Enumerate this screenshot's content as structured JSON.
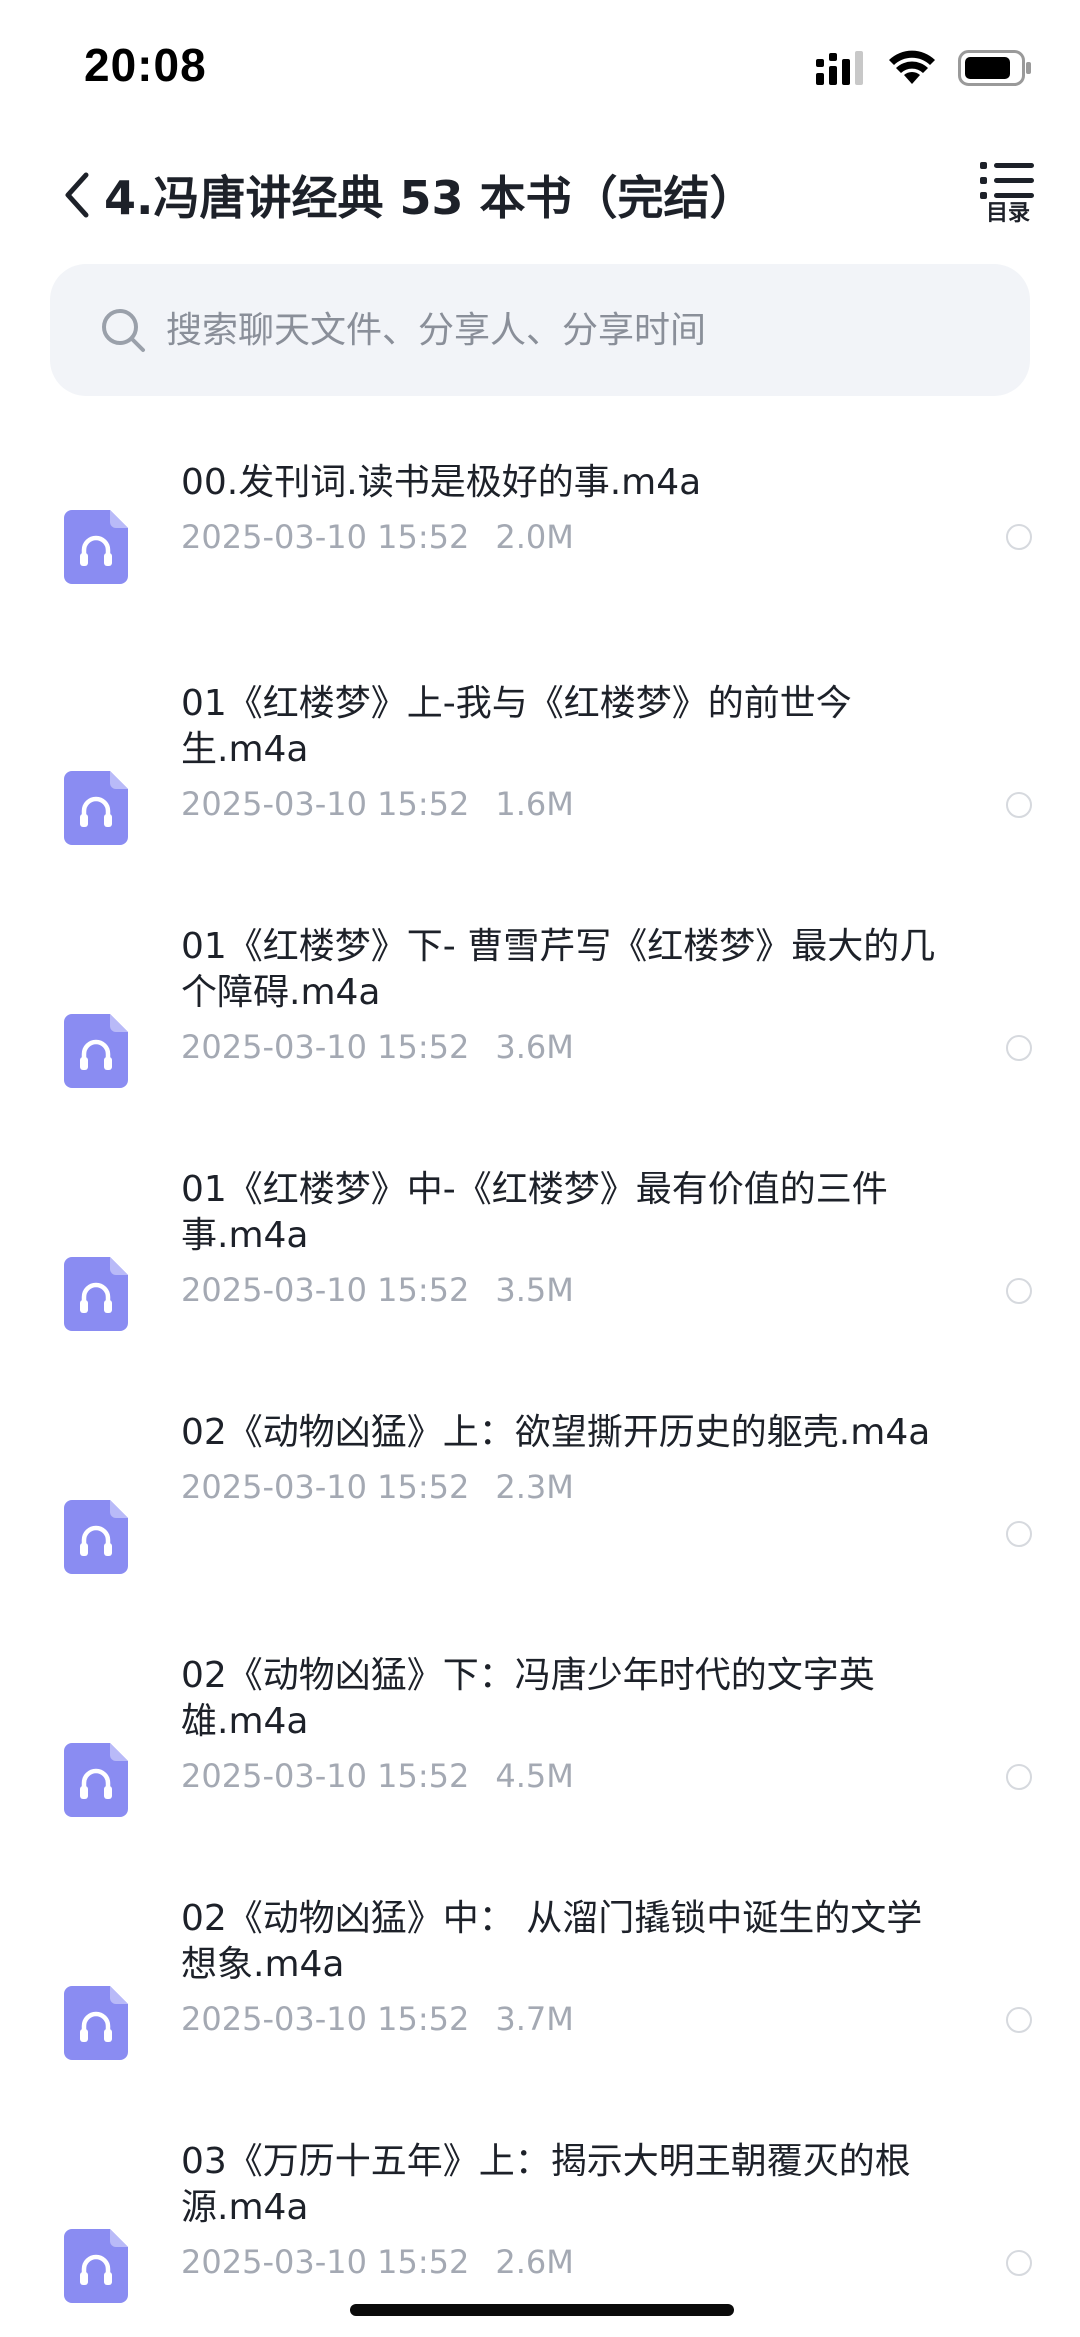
{
  "status_bar": {
    "time": "20:08"
  },
  "nav": {
    "title": "4.冯唐讲经典 53 本书（完结）",
    "toc_label": "目录"
  },
  "search": {
    "placeholder": "搜索聊天文件、分享人、分享时间"
  },
  "files": [
    {
      "name": "00.发刊词.读书是极好的事.m4a",
      "date": "2025-03-10 15:52",
      "size": "2.0M"
    },
    {
      "name": "01《红楼梦》上-我与《红楼梦》的前世今生.m4a",
      "date": "2025-03-10 15:52",
      "size": "1.6M"
    },
    {
      "name": "01《红楼梦》下- 曹雪芹写《红楼梦》最大的几个障碍.m4a",
      "date": "2025-03-10 15:52",
      "size": "3.6M"
    },
    {
      "name": "01《红楼梦》中-《红楼梦》最有价值的三件事.m4a",
      "date": "2025-03-10 15:52",
      "size": "3.5M"
    },
    {
      "name": "02《动物凶猛》上：欲望撕开历史的躯壳.m4a",
      "date": "2025-03-10 15:52",
      "size": "2.3M"
    },
    {
      "name": "02《动物凶猛》下：冯唐少年时代的文字英雄.m4a",
      "date": "2025-03-10 15:52",
      "size": "4.5M"
    },
    {
      "name": "02《动物凶猛》中： 从溜门撬锁中诞生的文学想象.m4a",
      "date": "2025-03-10 15:52",
      "size": "3.7M"
    },
    {
      "name": "03《万历十五年》上：揭示大明王朝覆灭的根源.m4a",
      "date": "2025-03-10 15:52",
      "size": "2.6M"
    }
  ],
  "colors": {
    "accent_icon": "#8a8cf2",
    "meta_text": "#a4a9b3",
    "search_bg": "#f2f4f8"
  },
  "icons": {
    "file": "audio-file-icon",
    "search": "search-icon",
    "back": "chevron-left-icon",
    "toc": "list-icon"
  }
}
